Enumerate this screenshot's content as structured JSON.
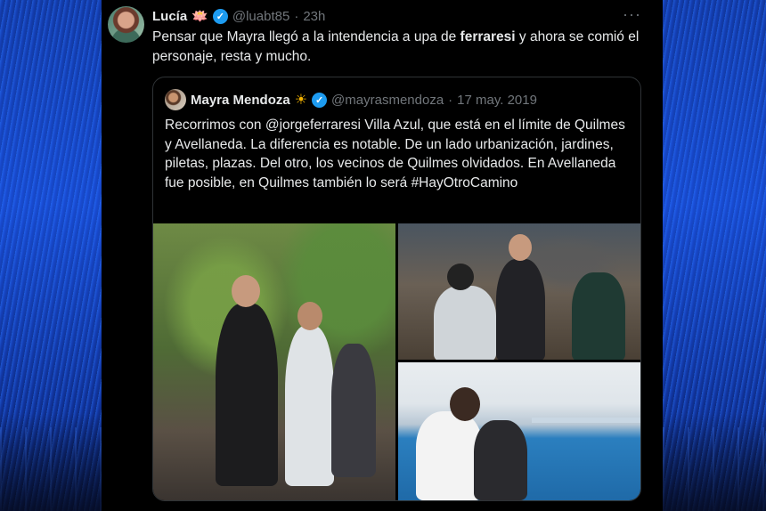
{
  "tweet": {
    "author_name": "Lucía",
    "author_emoji": "🪷",
    "handle": "@luabt85",
    "separator": "·",
    "time": "23h",
    "more_label": "···",
    "text_part1": "Pensar que Mayra llegó a la intendencia a upa de ",
    "text_bold": "ferraresi",
    "text_part2": " y ahora se comió el personaje, resta y mucho."
  },
  "quote": {
    "author_name": "Mayra Mendoza",
    "author_emoji": "☀",
    "handle": "@mayrasmendoza",
    "separator": "·",
    "date": "17 may. 2019",
    "text": "Recorrimos con @jorgeferraresi Villa Azul, que está en el límite de Quilmes y Avellaneda. La diferencia es notable. De un lado urbanización, jardines, piletas, plazas. Del otro, los vecinos de Quilmes olvidados. En Avellaneda fue posible, en Quilmes también lo será #HayOtroCamino"
  },
  "colors": {
    "text_primary": "#e7e9ea",
    "text_secondary": "#71767b",
    "verified_blue": "#1d9bf0",
    "border": "#2f3336",
    "background": "#000000"
  },
  "icons": {
    "verified": "verified-badge-icon",
    "more": "more-options-icon"
  }
}
